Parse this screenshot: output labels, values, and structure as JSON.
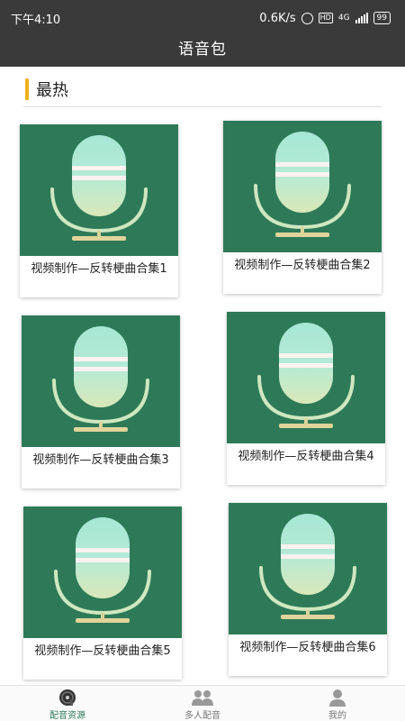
{
  "status_bar": {
    "time": "下午4:10",
    "speed": "0.6K/s",
    "hd": "HD",
    "network": "4G",
    "battery": "99"
  },
  "header": {
    "title": "语音包"
  },
  "section": {
    "title": "最热"
  },
  "cards": [
    {
      "title": "视频制作—反转梗曲合集1",
      "icon": "microphone-icon"
    },
    {
      "title": "视频制作—反转梗曲合集2",
      "icon": "microphone-icon"
    },
    {
      "title": "视频制作—反转梗曲合集3",
      "icon": "microphone-icon"
    },
    {
      "title": "视频制作—反转梗曲合集4",
      "icon": "microphone-icon"
    },
    {
      "title": "视频制作—反转梗曲合集5",
      "icon": "microphone-icon"
    },
    {
      "title": "视频制作—反转梗曲合集6",
      "icon": "microphone-icon"
    }
  ],
  "bottom_nav": [
    {
      "label": "配音资源",
      "icon": "dubbing-resources-icon",
      "active": true
    },
    {
      "label": "多人配音",
      "icon": "multi-user-icon",
      "active": false
    },
    {
      "label": "我的",
      "icon": "profile-icon",
      "active": false
    }
  ],
  "colors": {
    "app_bar": "#3a3a3a",
    "card_thumb": "#2e7a58",
    "accent": "#f0b21a"
  }
}
